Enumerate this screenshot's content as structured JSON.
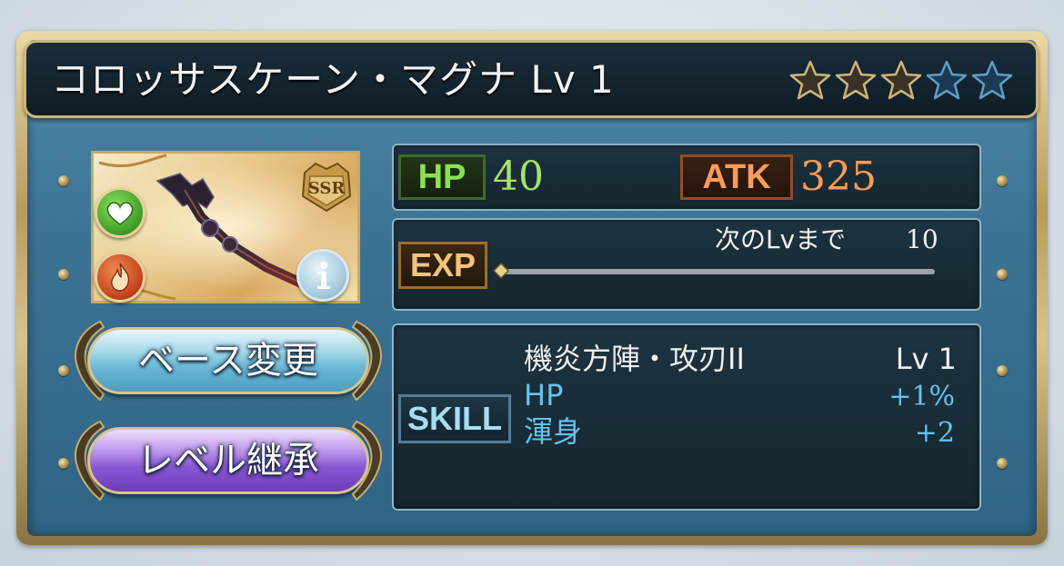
{
  "weapon": {
    "name": "コロッサスケーン・マグナ",
    "level_label": "Lv 1",
    "rarity_badge": "SSR",
    "stars": {
      "filled": 3,
      "total": 5
    }
  },
  "stats": {
    "hp_label": "HP",
    "hp_value": "40",
    "atk_label": "ATK",
    "atk_value": "325"
  },
  "exp": {
    "label": "EXP",
    "next_label": "次のLvまで",
    "next_value": "10",
    "progress": 0.0
  },
  "skill": {
    "label": "SKILL",
    "name": "機炎方陣・攻刃II",
    "level": "Lv 1",
    "effects": [
      {
        "name": "HP",
        "value": "+1%"
      },
      {
        "name": "渾身",
        "value": "+2"
      }
    ]
  },
  "buttons": {
    "base_change": "ベース変更",
    "level_inherit": "レベル継承"
  },
  "colors": {
    "hp": "#a6e26a",
    "atk": "#ff9b57",
    "skill_effect": "#62c3ee",
    "frame_gold": "#cdb57a",
    "panel_blue": "#3c7394"
  }
}
